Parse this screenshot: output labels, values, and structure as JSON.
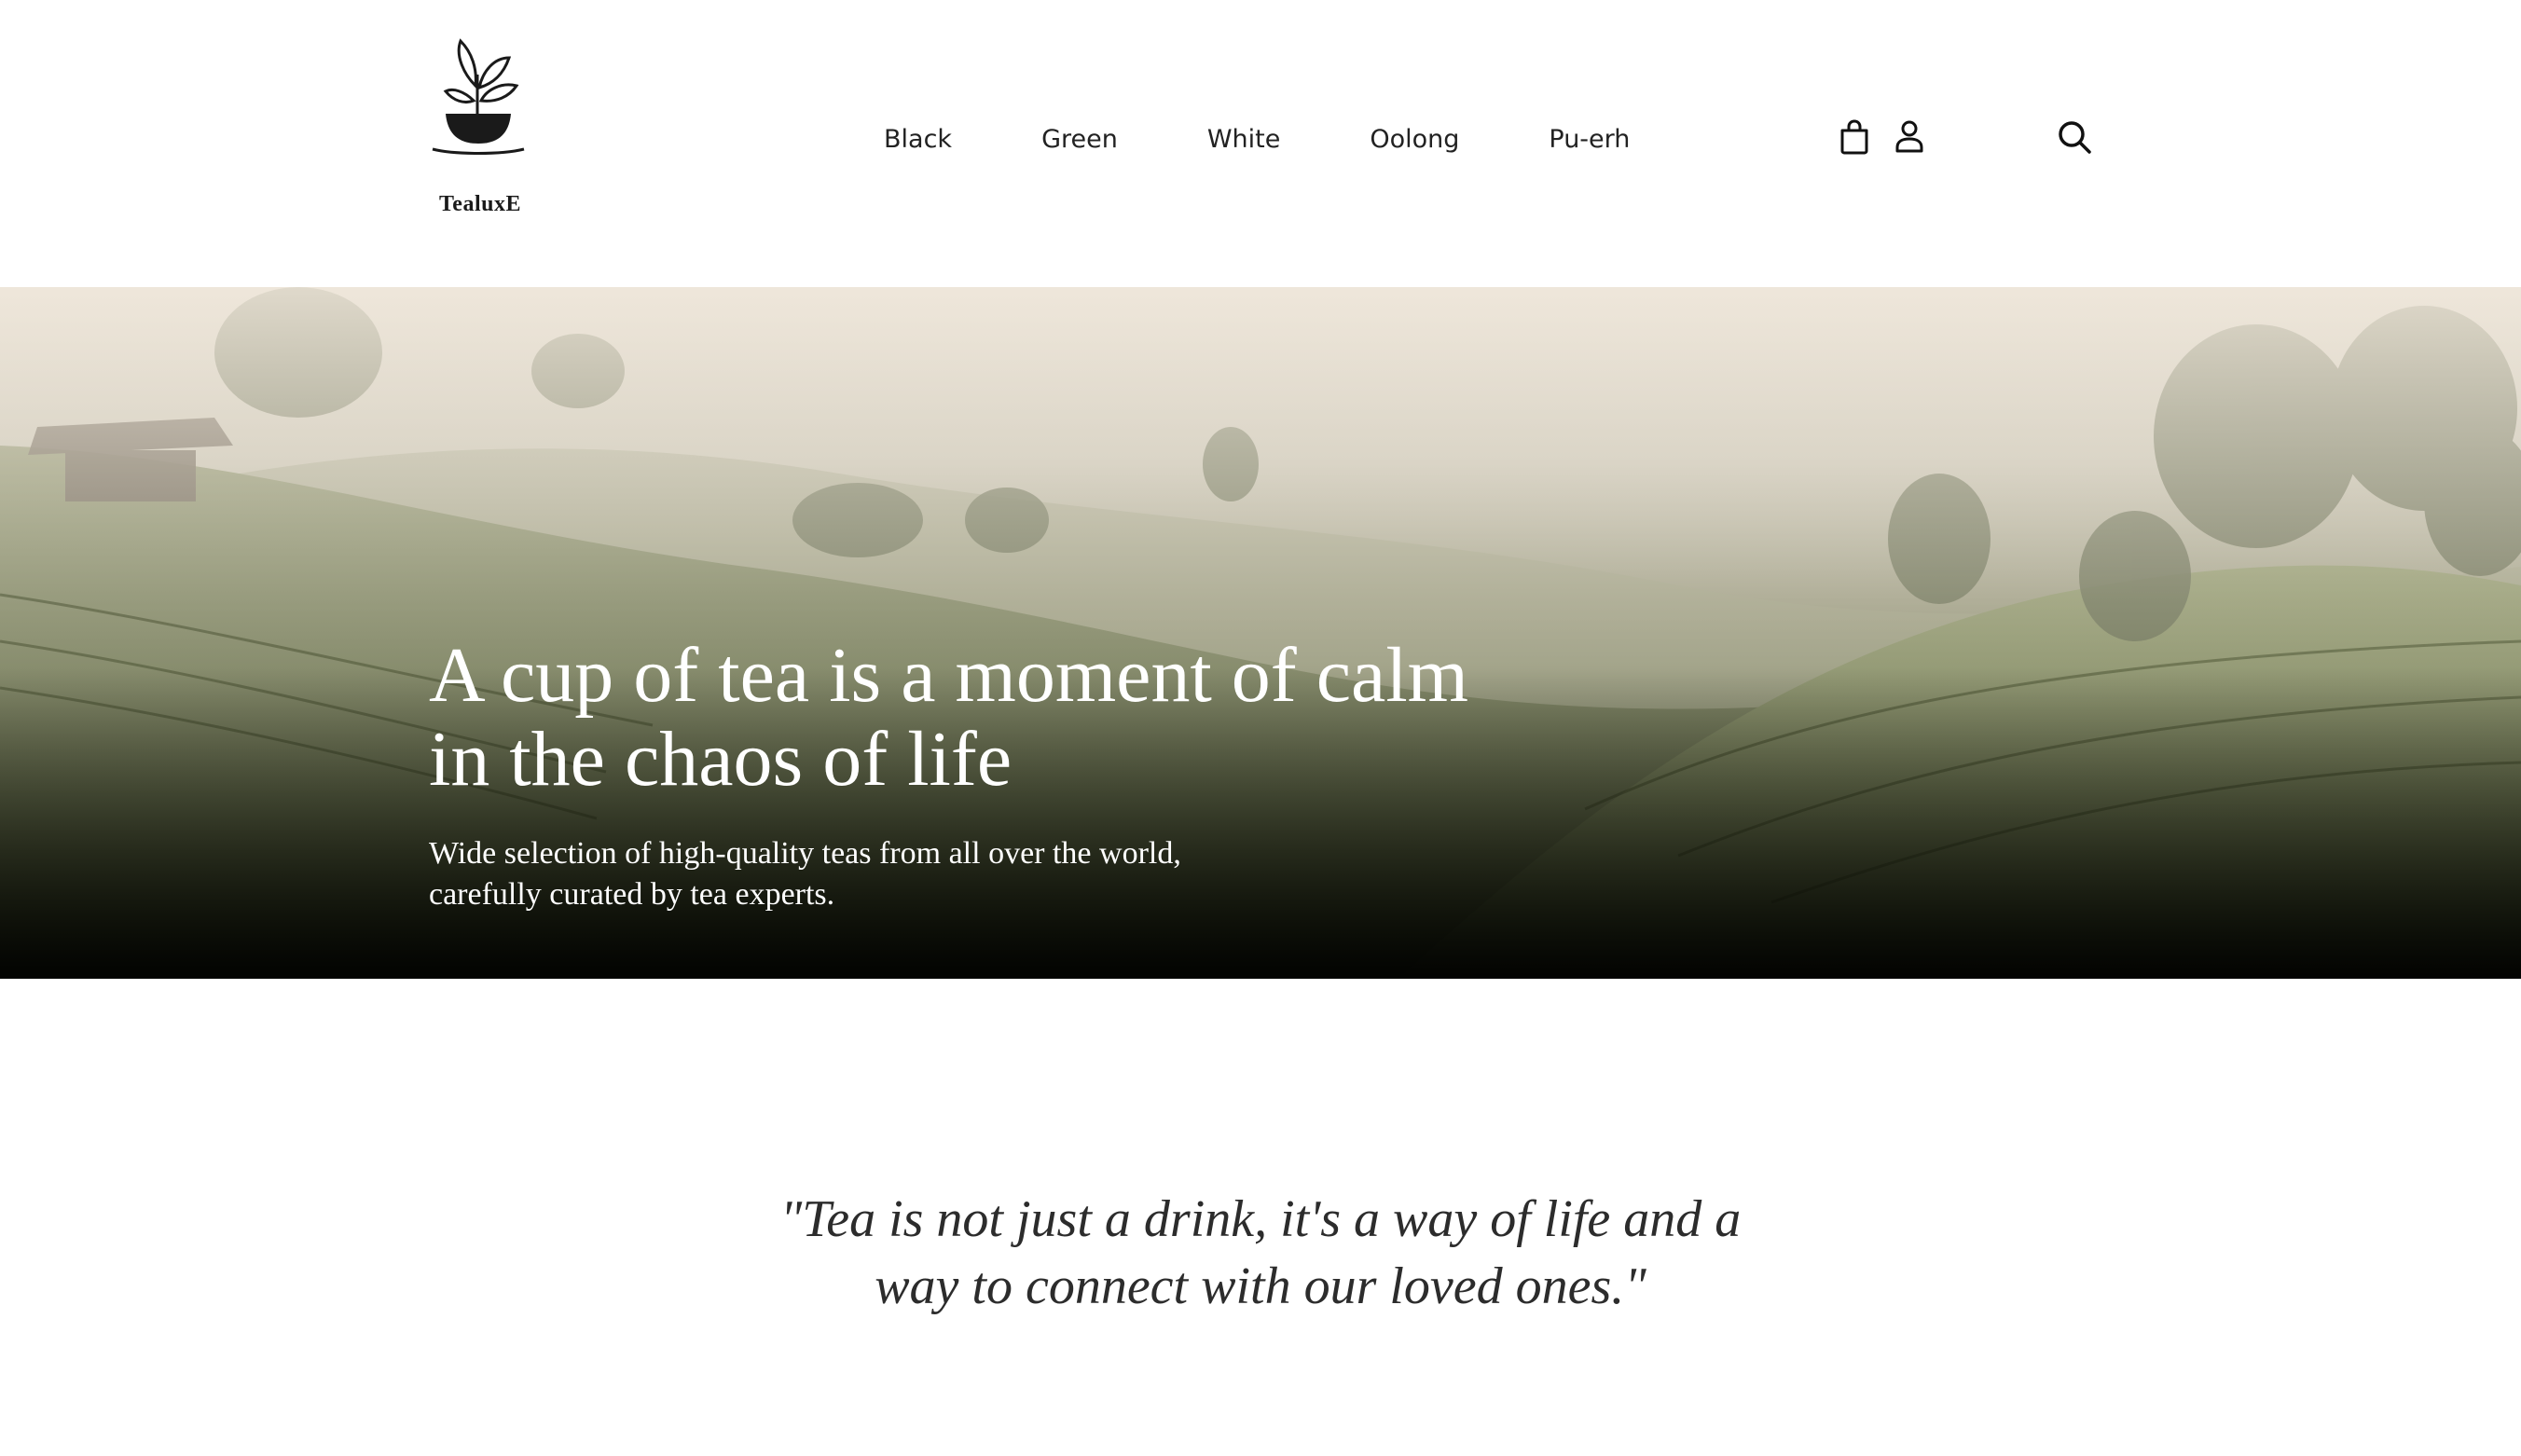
{
  "brand": {
    "name": "TealuxE"
  },
  "nav": {
    "items": [
      {
        "label": "Black"
      },
      {
        "label": "Green"
      },
      {
        "label": "White"
      },
      {
        "label": "Oolong"
      },
      {
        "label": "Pu-erh"
      }
    ]
  },
  "header_icons": {
    "cart": "shopping-bag-icon",
    "account": "user-icon",
    "search": "search-icon"
  },
  "hero": {
    "title_line1": "A cup of tea is a moment of calm",
    "title_line2": "in the chaos of life",
    "subtitle_line1": "Wide selection of high-quality teas from all over the world,",
    "subtitle_line2": "carefully curated by tea experts."
  },
  "quote": {
    "line1": "\"Tea is not just a drink, it's a way of life and a",
    "line2": "way to connect with our loved ones.\""
  },
  "colors": {
    "text": "#1a1a1a",
    "hero_text": "#ffffff",
    "background": "#ffffff"
  }
}
